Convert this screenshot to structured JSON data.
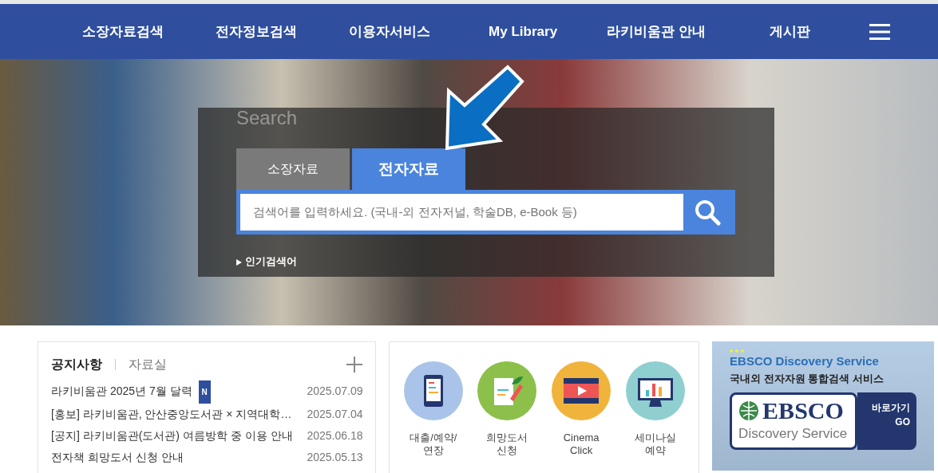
{
  "nav": {
    "items": [
      "소장자료검색",
      "전자정보검색",
      "이용자서비스",
      "My Library",
      "라키비움관 안내",
      "게시판"
    ]
  },
  "hero": {
    "search_label": "Search",
    "tabs": [
      {
        "label": "소장자료",
        "selected": false
      },
      {
        "label": "전자자료",
        "selected": true
      }
    ],
    "search": {
      "placeholder": "검색어를 입력하세요. (국내-외 전자저널, 학술DB, e-Book 등)"
    },
    "popular_label": "인기검색어"
  },
  "notices": {
    "tabs": [
      {
        "label": "공지사항",
        "selected": true
      },
      {
        "label": "자료실",
        "selected": false
      }
    ],
    "items": [
      {
        "title": "라키비움관 2025년 7월 달력",
        "badge": "N",
        "date": "2025.07.09"
      },
      {
        "title": "[홍보] 라키비움관, 안산중앙도서관 × 지역대학…",
        "date": "2025.07.04"
      },
      {
        "title": "[공지] 라키비움관(도서관) 여름방학 중 이용 안내",
        "date": "2025.06.18"
      },
      {
        "title": "전자책 희망도서 신청 안내",
        "date": "2025.05.13"
      }
    ]
  },
  "quick_links": [
    {
      "kind": "mobile",
      "color": "#a9c4e8",
      "label": "대출/예약/\n연장"
    },
    {
      "kind": "document",
      "color": "#8cc04a",
      "label": "희망도서\n신청"
    },
    {
      "kind": "film",
      "color": "#f0b43c",
      "label": "Cinema\nClick"
    },
    {
      "kind": "monitor",
      "color": "#8fcfd0",
      "label": "세미나실\n예약"
    }
  ],
  "banner": {
    "title": "EBSCO Discovery Service",
    "subtitle": "국내외 전자자원 통합검색 서비스",
    "logo": "EBSCO",
    "logo_sub": "Discovery Service",
    "go_label": "바로가기",
    "go": "GO"
  }
}
